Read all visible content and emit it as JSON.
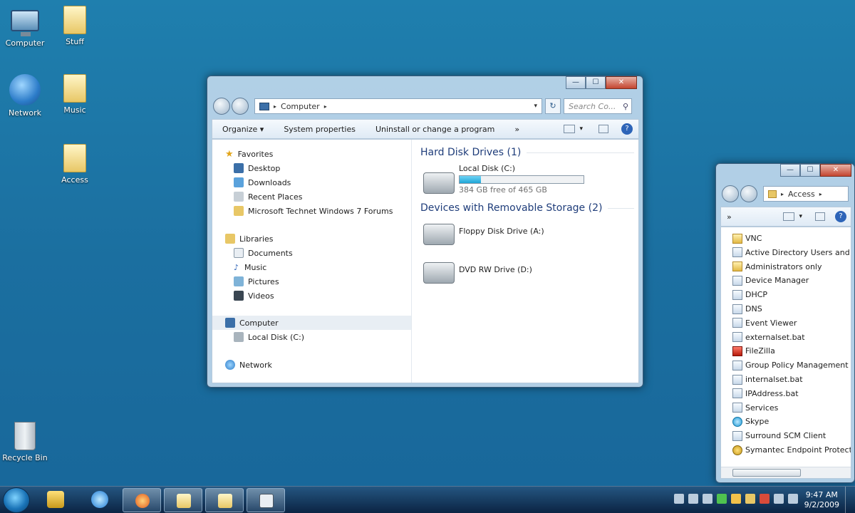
{
  "desktop_icons": [
    {
      "label": "Computer",
      "icon": "computer-icon"
    },
    {
      "label": "Stuff",
      "icon": "folder-icon"
    },
    {
      "label": "Network",
      "icon": "network-icon"
    },
    {
      "label": "Music",
      "icon": "folder-icon"
    },
    {
      "label": "Access",
      "icon": "folder-icon"
    },
    {
      "label": "Recycle Bin",
      "icon": "recycle-bin-icon"
    }
  ],
  "explorer": {
    "address": {
      "root": "Computer",
      "sep": "▸"
    },
    "search_placeholder": "Search Co...",
    "toolbar": {
      "organize": "Organize ▾",
      "system_properties": "System properties",
      "uninstall": "Uninstall or change a program",
      "more": "»"
    },
    "nav": {
      "favorites": "Favorites",
      "desktop": "Desktop",
      "downloads": "Downloads",
      "recent_places": "Recent Places",
      "technet": "Microsoft Technet Windows 7 Forums",
      "libraries": "Libraries",
      "documents": "Documents",
      "music": "Music",
      "pictures": "Pictures",
      "videos": "Videos",
      "computer": "Computer",
      "local_disk": "Local Disk (C:)",
      "network": "Network"
    },
    "groups": {
      "hard_disks": "Hard Disk Drives (1)",
      "removable": "Devices with Removable Storage (2)"
    },
    "drives": {
      "c_name": "Local Disk (C:)",
      "c_free": "384 GB free of 465 GB",
      "c_used_fraction": 0.17,
      "floppy": "Floppy Disk Drive (A:)",
      "dvd": "DVD RW Drive (D:)"
    }
  },
  "access_window": {
    "address": "Access",
    "more": "»",
    "files": [
      {
        "name": "VNC",
        "icon": "folder"
      },
      {
        "name": "Active Directory Users and Co",
        "icon": "shortcut"
      },
      {
        "name": "Administrators only",
        "icon": "folder"
      },
      {
        "name": "Device Manager",
        "icon": "shortcut"
      },
      {
        "name": "DHCP",
        "icon": "shortcut"
      },
      {
        "name": "DNS",
        "icon": "shortcut"
      },
      {
        "name": "Event Viewer",
        "icon": "shortcut"
      },
      {
        "name": "externalset.bat",
        "icon": "shortcut"
      },
      {
        "name": "FileZilla",
        "icon": "red"
      },
      {
        "name": "Group Policy Management",
        "icon": "shortcut"
      },
      {
        "name": "internalset.bat",
        "icon": "shortcut"
      },
      {
        "name": "IPAddress.bat",
        "icon": "shortcut"
      },
      {
        "name": "Services",
        "icon": "shortcut"
      },
      {
        "name": "Skype",
        "icon": "skype"
      },
      {
        "name": "Surround SCM Client",
        "icon": "shortcut"
      },
      {
        "name": "Symantec Endpoint Protectio",
        "icon": "sym"
      }
    ]
  },
  "taskbar": {
    "time": "9:47 AM",
    "date": "9/2/2009"
  }
}
